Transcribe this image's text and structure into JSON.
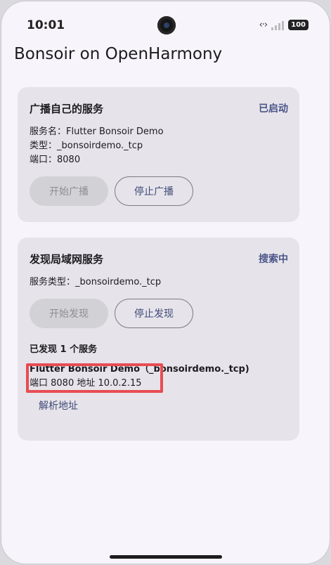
{
  "status_bar": {
    "time": "10:01",
    "battery": "100",
    "signal_icon": "data-transfer-icon"
  },
  "app": {
    "title": "Bonsoir on OpenHarmony"
  },
  "broadcast": {
    "title": "广播自己的服务",
    "status": "已启动",
    "service_name": "服务名：Flutter Bonsoir Demo",
    "type": "类型：_bonsoirdemo._tcp",
    "port": "端口：8080",
    "start_button": "开始广播",
    "stop_button": "停止广播"
  },
  "discovery": {
    "title": "发现局域网服务",
    "status": "搜索中",
    "service_type": "服务类型：_bonsoirdemo._tcp",
    "start_button": "开始发现",
    "stop_button": "停止发现",
    "found_count": "已发现 1 个服务",
    "service_name": "Flutter Bonsoir Demo（_bonsoirdemo._tcp)",
    "service_detail": "端口 8080   地址 10.0.2.15",
    "resolve_link": "解析地址"
  },
  "colors": {
    "accent": "#4a5588",
    "highlight": "#e74c52",
    "card_bg": "#e6e4ea",
    "page_bg": "#f7f5fb"
  }
}
